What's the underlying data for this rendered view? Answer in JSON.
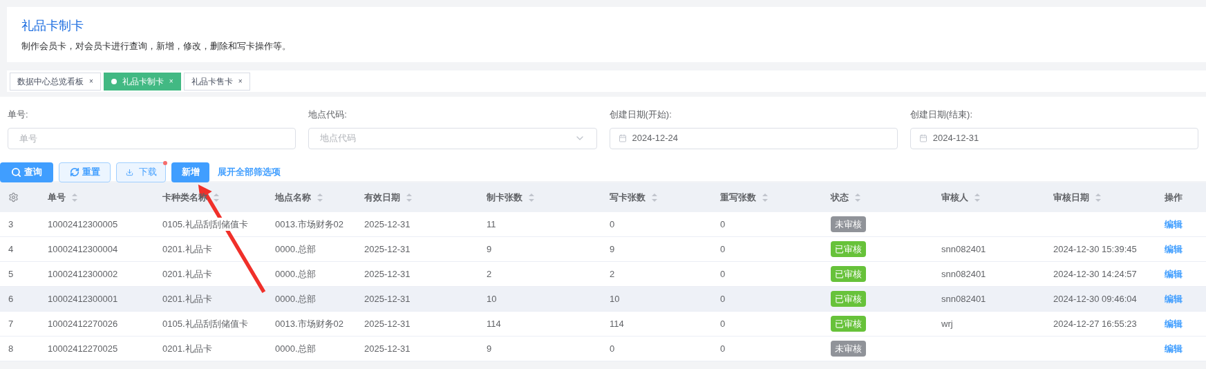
{
  "header": {
    "title": "礼品卡制卡",
    "description": "制作会员卡，对会员卡进行查询，新增，修改，删除和写卡操作等。"
  },
  "tabs": [
    {
      "label": "数据中心总览看板",
      "close": "×",
      "selected": false
    },
    {
      "label": "礼品卡制卡",
      "close": "×",
      "selected": true
    },
    {
      "label": "礼品卡售卡",
      "close": "×",
      "selected": false
    }
  ],
  "filters": [
    {
      "label": "单号:",
      "kind": "text",
      "placeholder": "单号"
    },
    {
      "label": "地点代码:",
      "kind": "select",
      "placeholder": "地点代码"
    },
    {
      "label": "创建日期(开始):",
      "kind": "date",
      "value": "2024-12-24"
    },
    {
      "label": "创建日期(结束):",
      "kind": "date",
      "value": "2024-12-31"
    }
  ],
  "actions": [
    {
      "label": "查询",
      "kind": "search",
      "badge_dot": false
    },
    {
      "label": "重置",
      "kind": "reset",
      "badge_dot": false
    },
    {
      "label": "下载",
      "kind": "download",
      "badge_dot": true
    },
    {
      "label": "新增",
      "kind": "add",
      "badge_dot": false
    },
    {
      "label": "展开全部筛选项",
      "kind": "link",
      "badge_dot": false
    }
  ],
  "table": {
    "columns": [
      "",
      "单号",
      "卡种类名称",
      "地点名称",
      "有效日期",
      "制卡张数",
      "写卡张数",
      "重写张数",
      "状态",
      "审核人",
      "审核日期",
      "操作"
    ],
    "rows": [
      {
        "cells": [
          "3",
          "10002412300005",
          "0105.礼品刮刮储值卡",
          "0013.市场财务02",
          "2025-12-31",
          "11",
          "0",
          "0"
        ],
        "status": "未审核",
        "color": "#909399",
        "reviewer": "",
        "review_date": "",
        "action": "编辑",
        "highlighted": false
      },
      {
        "cells": [
          "4",
          "10002412300004",
          "0201.礼品卡",
          "0000.总部",
          "2025-12-31",
          "9",
          "9",
          "0"
        ],
        "status": "已审核",
        "color": "#67c23a",
        "reviewer": "snn082401",
        "review_date": "2024-12-30 15:39:45",
        "action": "编辑",
        "highlighted": false
      },
      {
        "cells": [
          "5",
          "10002412300002",
          "0201.礼品卡",
          "0000.总部",
          "2025-12-31",
          "2",
          "2",
          "0"
        ],
        "status": "已审核",
        "color": "#67c23a",
        "reviewer": "snn082401",
        "review_date": "2024-12-30 14:24:57",
        "action": "编辑",
        "highlighted": false
      },
      {
        "cells": [
          "6",
          "10002412300001",
          "0201.礼品卡",
          "0000.总部",
          "2025-12-31",
          "10",
          "10",
          "0"
        ],
        "status": "已审核",
        "color": "#67c23a",
        "reviewer": "snn082401",
        "review_date": "2024-12-30 09:46:04",
        "action": "编辑",
        "highlighted": true
      },
      {
        "cells": [
          "7",
          "10002412270026",
          "0105.礼品刮刮储值卡",
          "0013.市场财务02",
          "2025-12-31",
          "114",
          "114",
          "0"
        ],
        "status": "已审核",
        "color": "#67c23a",
        "reviewer": "wrj",
        "review_date": "2024-12-27 16:55:23",
        "action": "编辑",
        "highlighted": false
      },
      {
        "cells": [
          "8",
          "10002412270025",
          "0201.礼品卡",
          "0000.总部",
          "2025-12-31",
          "9",
          "0",
          "0"
        ],
        "status": "未审核",
        "color": "#909399",
        "reviewer": "",
        "review_date": "",
        "action": "编辑",
        "highlighted": false
      }
    ]
  },
  "annotation": {
    "kind": "arrow"
  }
}
